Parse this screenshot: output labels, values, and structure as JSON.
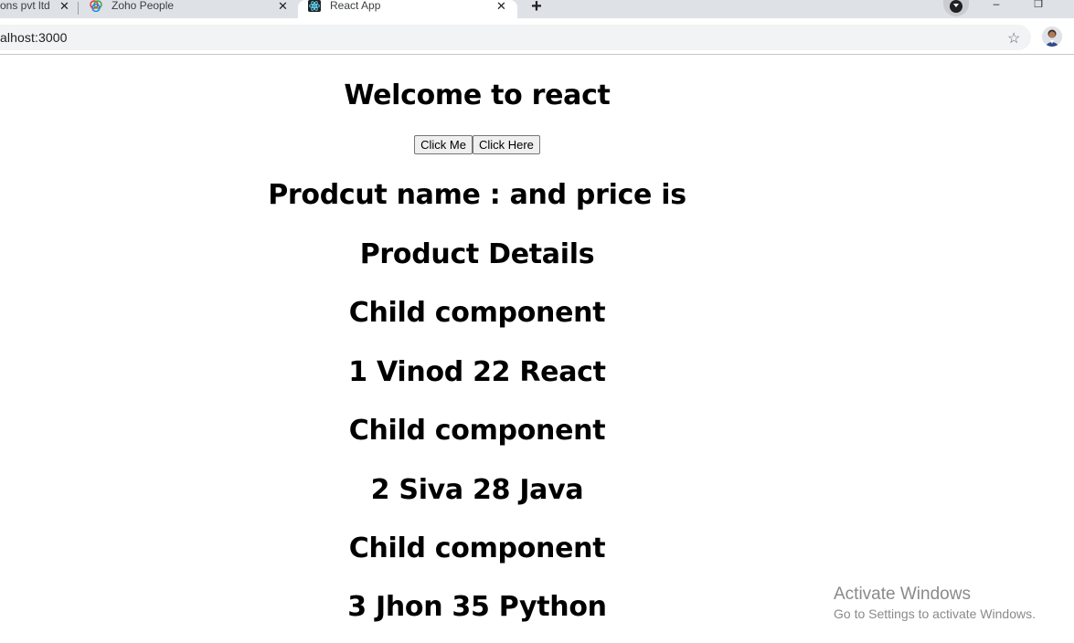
{
  "browser": {
    "tabs": [
      {
        "title": "ons pvt ltd",
        "close": "✕"
      },
      {
        "title": "Zoho People",
        "close": "✕"
      },
      {
        "title": "React App",
        "close": "✕"
      }
    ],
    "new_tab": "+",
    "url": "alhost:3000",
    "star_icon": "☆",
    "window_minimize": "‒",
    "window_restore": "❐"
  },
  "page": {
    "heading": "Welcome to react",
    "buttons": [
      "Click Me",
      "Click Here"
    ],
    "product_line": "Prodcut name : and price is",
    "product_details": "Product Details",
    "children": [
      {
        "label": "Child component",
        "row": "1 Vinod 22 React"
      },
      {
        "label": "Child component",
        "row": "2 Siva 28 Java"
      },
      {
        "label": "Child component",
        "row": "3 Jhon 35 Python"
      }
    ]
  },
  "watermark": {
    "title": "Activate Windows",
    "subtitle": "Go to Settings to activate Windows."
  }
}
